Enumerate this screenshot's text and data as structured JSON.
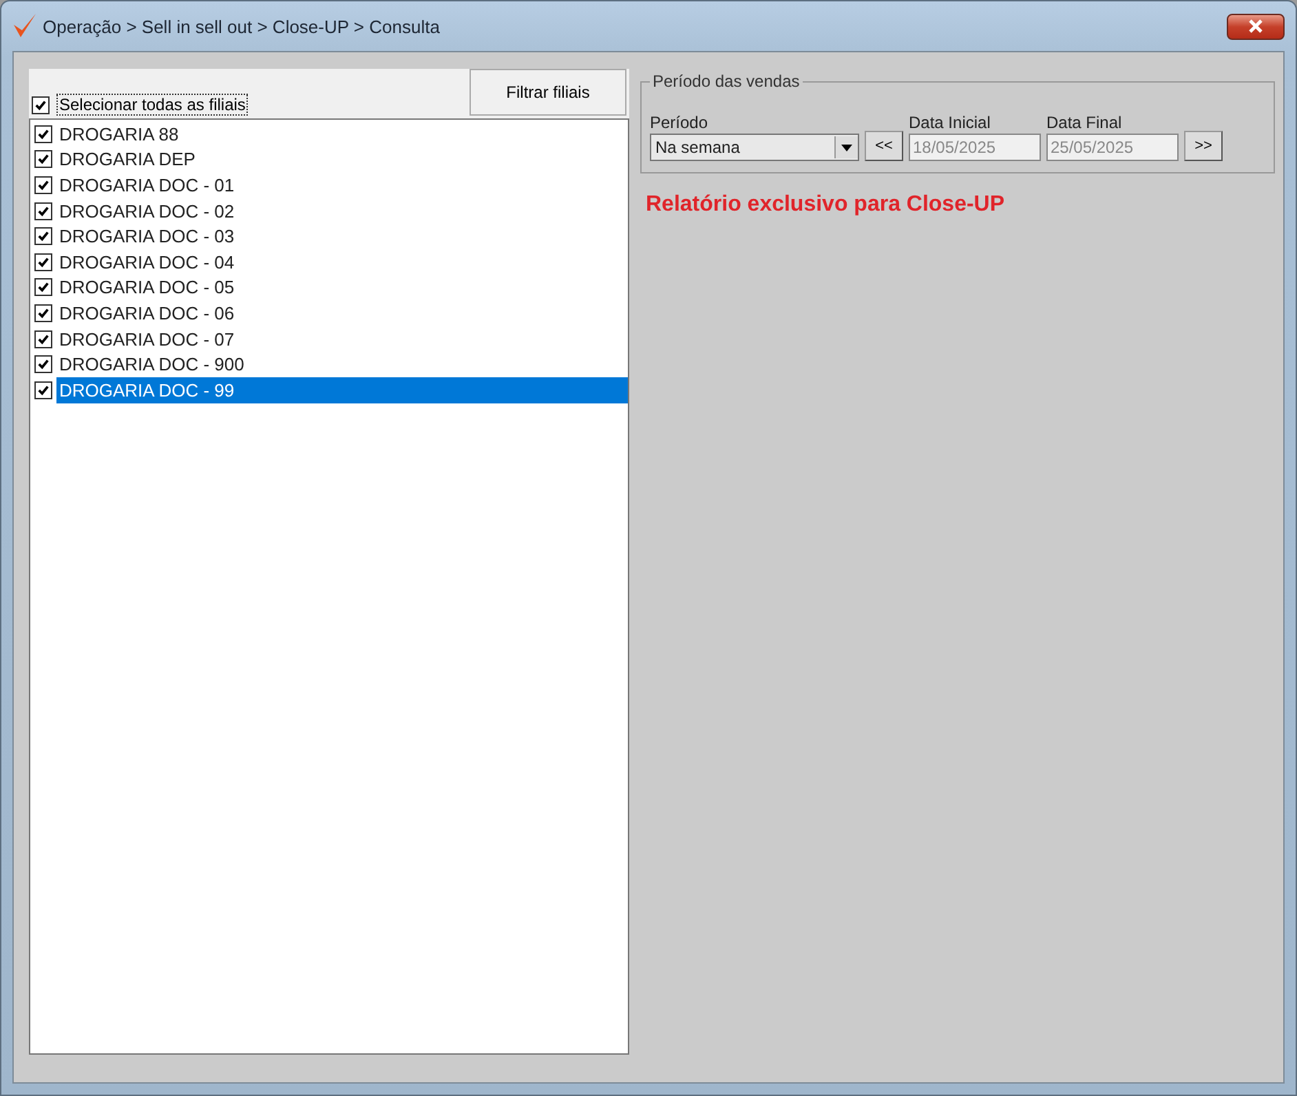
{
  "window": {
    "title": "Operação > Sell in sell out > Close-UP > Consulta"
  },
  "branches": {
    "select_all": {
      "label": "Selecionar todas as filiais",
      "checked": true
    },
    "filter_button": "Filtrar filiais",
    "items": [
      {
        "label": "DROGARIA 88",
        "checked": true,
        "selected": false
      },
      {
        "label": "DROGARIA DEP",
        "checked": true,
        "selected": false
      },
      {
        "label": "DROGARIA DOC - 01",
        "checked": true,
        "selected": false
      },
      {
        "label": "DROGARIA DOC - 02",
        "checked": true,
        "selected": false
      },
      {
        "label": "DROGARIA DOC - 03",
        "checked": true,
        "selected": false
      },
      {
        "label": "DROGARIA DOC - 04",
        "checked": true,
        "selected": false
      },
      {
        "label": "DROGARIA DOC - 05",
        "checked": true,
        "selected": false
      },
      {
        "label": "DROGARIA DOC - 06",
        "checked": true,
        "selected": false
      },
      {
        "label": "DROGARIA DOC - 07",
        "checked": true,
        "selected": false
      },
      {
        "label": "DROGARIA DOC - 900",
        "checked": true,
        "selected": false
      },
      {
        "label": "DROGARIA DOC - 99",
        "checked": true,
        "selected": true
      }
    ]
  },
  "period_group": {
    "title": "Período das vendas",
    "period": {
      "label": "Período",
      "value": "Na semana"
    },
    "prev_button": "<<",
    "start_date": {
      "label": "Data Inicial",
      "value": "18/05/2025",
      "disabled": true
    },
    "end_date": {
      "label": "Data Final",
      "value": "25/05/2025",
      "disabled": true
    },
    "next_button": ">>"
  },
  "notice": "Relatório exclusivo para Close-UP"
}
